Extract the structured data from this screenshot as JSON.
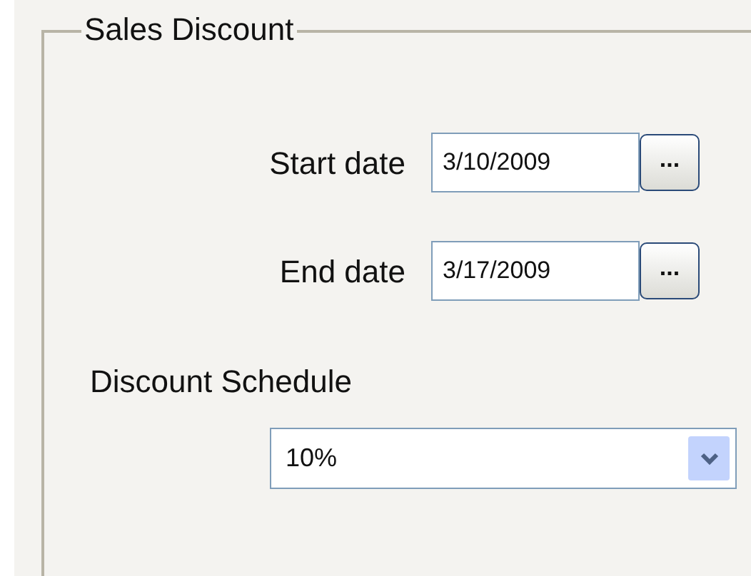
{
  "group": {
    "title": "Sales Discount"
  },
  "date_fields": [
    {
      "label": "Start date",
      "value": "3/10/2009",
      "button": "..."
    },
    {
      "label": "End date",
      "value": "3/17/2009",
      "button": "..."
    }
  ],
  "schedule": {
    "label": "Discount Schedule",
    "value": "10%"
  }
}
